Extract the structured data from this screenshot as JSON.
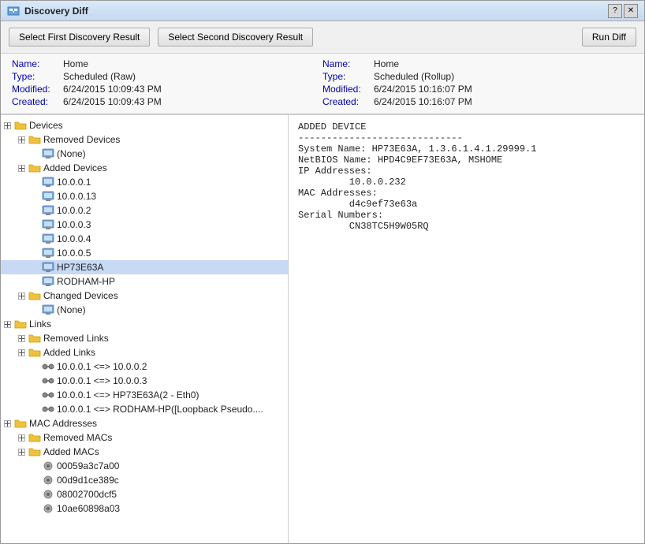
{
  "window": {
    "title": "Discovery Diff",
    "title_icon": "diff-icon"
  },
  "toolbar": {
    "btn_first": "Select First Discovery Result",
    "btn_second": "Select Second Discovery Result",
    "btn_run": "Run Diff"
  },
  "info_left": {
    "name_label": "Name:",
    "name_value": "Home",
    "type_label": "Type:",
    "type_value": "Scheduled (Raw)",
    "modified_label": "Modified:",
    "modified_value": "6/24/2015 10:09:43 PM",
    "created_label": "Created:",
    "created_value": "6/24/2015 10:09:43 PM"
  },
  "info_right": {
    "name_label": "Name:",
    "name_value": "Home",
    "type_label": "Type:",
    "type_value": "Scheduled (Rollup)",
    "modified_label": "Modified:",
    "modified_value": "6/24/2015 10:16:07 PM",
    "created_label": "Created:",
    "created_value": "6/24/2015 10:16:07 PM"
  },
  "detail_text": "ADDED DEVICE\n-----------------------------\nSystem Name: HP73E63A, 1.3.6.1.4.1.29999.1\nNetBIOS Name: HPD4C9EF73E63A, MSHOME\nIP Addresses:\n         10.0.0.232\nMAC Addresses:\n         d4c9ef73e63a\nSerial Numbers:\n         CN38TC5H9W05RQ",
  "tree": {
    "items": [
      {
        "id": "devices",
        "label": "Devices",
        "level": 0,
        "type": "folder",
        "toggle": "expand",
        "selected": false
      },
      {
        "id": "removed-devices",
        "label": "Removed Devices",
        "level": 1,
        "type": "folder",
        "toggle": "expand",
        "selected": false
      },
      {
        "id": "none-removed",
        "label": "(None)",
        "level": 2,
        "type": "device",
        "toggle": "none",
        "selected": false
      },
      {
        "id": "added-devices",
        "label": "Added Devices",
        "level": 1,
        "type": "folder",
        "toggle": "expand",
        "selected": false
      },
      {
        "id": "ip-10001",
        "label": "10.0.0.1",
        "level": 2,
        "type": "device",
        "toggle": "none",
        "selected": false
      },
      {
        "id": "ip-100013",
        "label": "10.0.0.13",
        "level": 2,
        "type": "device",
        "toggle": "none",
        "selected": false
      },
      {
        "id": "ip-10002",
        "label": "10.0.0.2",
        "level": 2,
        "type": "device",
        "toggle": "none",
        "selected": false
      },
      {
        "id": "ip-10003",
        "label": "10.0.0.3",
        "level": 2,
        "type": "device",
        "toggle": "none",
        "selected": false
      },
      {
        "id": "ip-10004",
        "label": "10.0.0.4",
        "level": 2,
        "type": "device",
        "toggle": "none",
        "selected": false
      },
      {
        "id": "ip-10005",
        "label": "10.0.0.5",
        "level": 2,
        "type": "device",
        "toggle": "none",
        "selected": false
      },
      {
        "id": "hp73e63a",
        "label": "HP73E63A",
        "level": 2,
        "type": "device",
        "toggle": "none",
        "selected": true
      },
      {
        "id": "rodham-hp",
        "label": "RODHAM-HP",
        "level": 2,
        "type": "device",
        "toggle": "none",
        "selected": false
      },
      {
        "id": "changed-devices",
        "label": "Changed Devices",
        "level": 1,
        "type": "folder",
        "toggle": "expand",
        "selected": false
      },
      {
        "id": "none-changed",
        "label": "(None)",
        "level": 2,
        "type": "device",
        "toggle": "none",
        "selected": false
      },
      {
        "id": "links",
        "label": "Links",
        "level": 0,
        "type": "folder",
        "toggle": "expand",
        "selected": false
      },
      {
        "id": "removed-links",
        "label": "Removed Links",
        "level": 1,
        "type": "folder",
        "toggle": "expand",
        "selected": false
      },
      {
        "id": "added-links",
        "label": "Added Links",
        "level": 1,
        "type": "folder",
        "toggle": "expand",
        "selected": false
      },
      {
        "id": "link1",
        "label": "10.0.0.1 <=> 10.0.0.2",
        "level": 2,
        "type": "link",
        "toggle": "none",
        "selected": false
      },
      {
        "id": "link2",
        "label": "10.0.0.1 <=> 10.0.0.3",
        "level": 2,
        "type": "link",
        "toggle": "none",
        "selected": false
      },
      {
        "id": "link3",
        "label": "10.0.0.1 <=> HP73E63A(2 - Eth0)",
        "level": 2,
        "type": "link",
        "toggle": "none",
        "selected": false
      },
      {
        "id": "link4",
        "label": "10.0.0.1 <=> RODHAM-HP([Loopback Pseudo....",
        "level": 2,
        "type": "link",
        "toggle": "none",
        "selected": false
      },
      {
        "id": "mac-addresses",
        "label": "MAC Addresses",
        "level": 0,
        "type": "folder",
        "toggle": "expand",
        "selected": false
      },
      {
        "id": "removed-macs",
        "label": "Removed MACs",
        "level": 1,
        "type": "folder",
        "toggle": "expand",
        "selected": false
      },
      {
        "id": "added-macs",
        "label": "Added MACs",
        "level": 1,
        "type": "folder",
        "toggle": "expand",
        "selected": false
      },
      {
        "id": "mac1",
        "label": "00059a3c7a00",
        "level": 2,
        "type": "mac",
        "toggle": "none",
        "selected": false
      },
      {
        "id": "mac2",
        "label": "00d9d1ce389c",
        "level": 2,
        "type": "mac",
        "toggle": "none",
        "selected": false
      },
      {
        "id": "mac3",
        "label": "08002700dcf5",
        "level": 2,
        "type": "mac",
        "toggle": "none",
        "selected": false
      },
      {
        "id": "mac4",
        "label": "10ae60898a03",
        "level": 2,
        "type": "mac",
        "toggle": "none",
        "selected": false
      }
    ]
  }
}
